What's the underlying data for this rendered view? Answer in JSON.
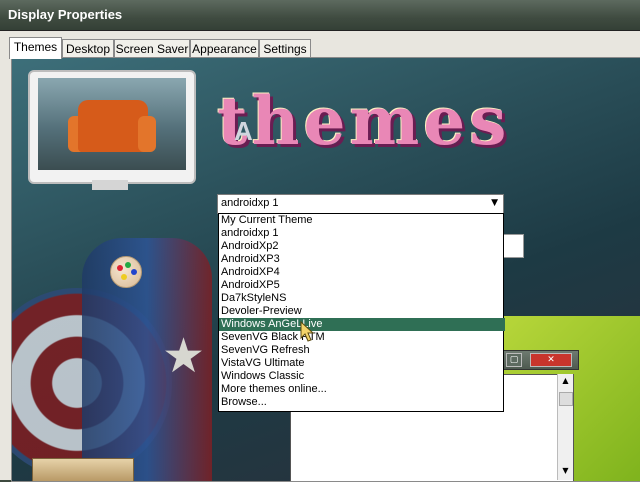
{
  "window": {
    "title": "Display Properties"
  },
  "tabs": [
    {
      "label": "Themes",
      "active": true
    },
    {
      "label": "Desktop",
      "active": false
    },
    {
      "label": "Screen Saver",
      "active": false
    },
    {
      "label": "Appearance",
      "active": false
    },
    {
      "label": "Settings",
      "active": false
    }
  ],
  "wallpaper": {
    "banner_text": "themes",
    "accent_letter": "A"
  },
  "theme_selector": {
    "selected": "androidxp 1",
    "options": [
      "My Current Theme",
      "androidxp 1",
      "AndroidXp2",
      "AndroidXP3",
      "AndroidXP4",
      "AndroidXP5",
      "Da7kStyleNS",
      "Devoler-Preview",
      "Windows AnGeLLive",
      "SevenVG Black RTM",
      "SevenVG Refresh",
      "VistaVG Ultimate",
      "Windows Classic",
      "More themes online...",
      "Browse..."
    ],
    "highlighted": "Windows AnGeLLive"
  },
  "colors": {
    "title_bar": "#3f4b40",
    "selection": "#2f6f55",
    "banner_pink": "#e987b6",
    "lime": "#9cc42b"
  },
  "icons": {
    "dropdown_arrow": "chevron-down-icon",
    "palette": "palette-icon",
    "close": "close-icon",
    "maximize": "maximize-icon",
    "pointer": "mouse-pointer-icon"
  }
}
